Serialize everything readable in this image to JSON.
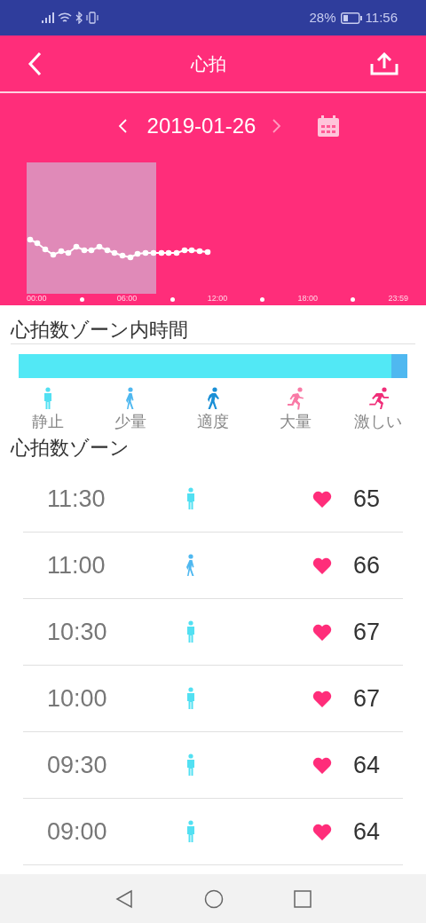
{
  "status_bar": {
    "battery": "28%",
    "time": "11:56"
  },
  "header": {
    "title": "心拍"
  },
  "date_nav": {
    "date": "2019-01-26"
  },
  "chart": {
    "x_labels": [
      "00:00",
      "06:00",
      "12:00",
      "18:00",
      "23:59"
    ]
  },
  "zone_time": {
    "title": "心拍数ゾーン内時間",
    "segments": [
      {
        "color": "#52e8f5",
        "level": 0.96
      },
      {
        "color": "#4fb8f0",
        "level": 0.04
      }
    ]
  },
  "zones": [
    {
      "kind": "stand",
      "label": "静止",
      "color": "#52e0f2"
    },
    {
      "kind": "walk",
      "label": "少量",
      "color": "#4fb8f0"
    },
    {
      "kind": "brisk",
      "label": "適度",
      "color": "#1a8fd6"
    },
    {
      "kind": "run",
      "label": "大量",
      "color": "#f97aa6"
    },
    {
      "kind": "sprint",
      "label": "激しい",
      "color": "#f02d78"
    }
  ],
  "zone_list": {
    "title": "心拍数ゾーン",
    "rows": [
      {
        "time": "11:30",
        "kind": "stand",
        "bpm": "65"
      },
      {
        "time": "11:00",
        "kind": "walk",
        "bpm": "66"
      },
      {
        "time": "10:30",
        "kind": "stand",
        "bpm": "67"
      },
      {
        "time": "10:00",
        "kind": "stand",
        "bpm": "67"
      },
      {
        "time": "09:30",
        "kind": "stand",
        "bpm": "64"
      },
      {
        "time": "09:00",
        "kind": "stand",
        "bpm": "64"
      }
    ]
  }
}
